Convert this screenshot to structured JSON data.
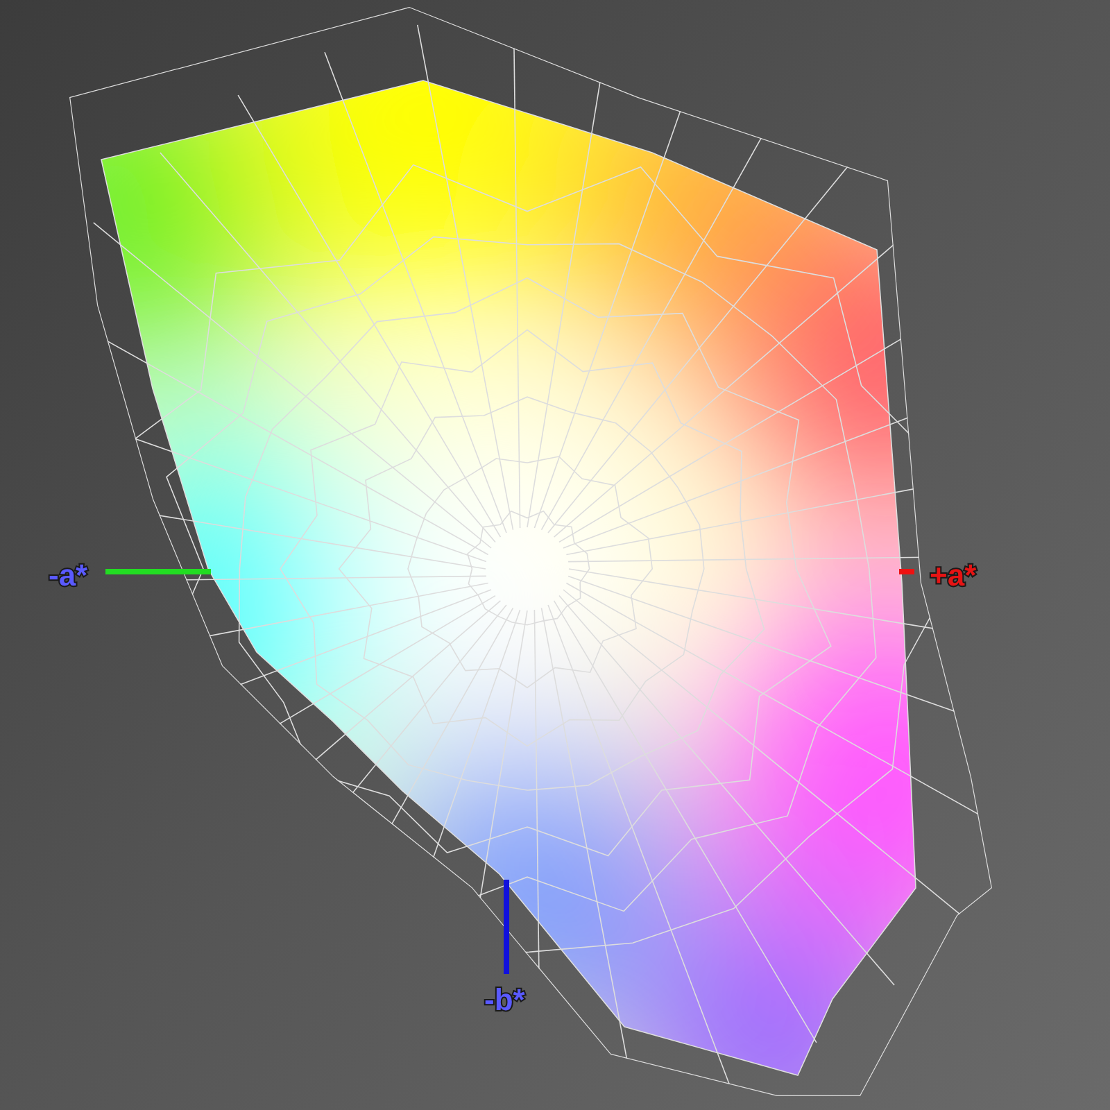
{
  "axes": [
    {
      "label": "-a*",
      "kind": "negative",
      "color": "#22dd22"
    },
    {
      "label": "+a*",
      "kind": "positive",
      "color": "#ee1111"
    },
    {
      "label": "-b*",
      "kind": "negative",
      "color": "#1111dd"
    }
  ]
}
